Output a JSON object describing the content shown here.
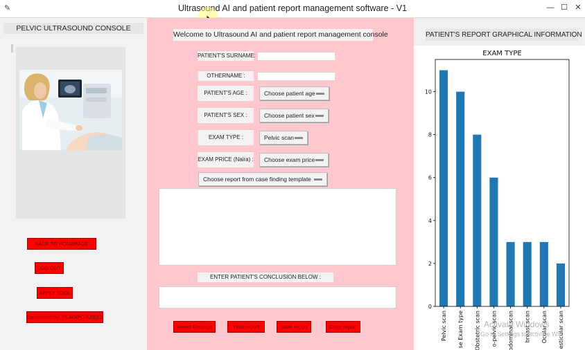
{
  "window": {
    "title": "Ultrasound AI and patient report management software - V1"
  },
  "left": {
    "heading": "PELVIC ULTRASOUND CONSOLE",
    "buttons": [
      {
        "label": "BACK TO HOMEPAGE",
        "name": "back-to-homepage-button"
      },
      {
        "label": "LOG OUT",
        "name": "log-out-button"
      },
      {
        "label": "APPLY TOOL",
        "name": "apply-tool-button"
      },
      {
        "label": "Developed by: OLADIPO AZEEZ",
        "name": "developer-credit-button"
      }
    ]
  },
  "middle": {
    "welcome": "Welcome to Ultrasound AI and patient report management console",
    "surname_label": "PATIENT'S SURNAME:",
    "surname_value": "",
    "othername_label": "OTHERNAME :",
    "othername_value": "",
    "age_label": "PATIENT'S AGE :",
    "age_value": "Choose patient age",
    "sex_label": "PATIENT'S SEX :",
    "sex_value": "Choose patient sex",
    "exam_type_label": "EXAM TYPE :",
    "exam_type_value": "Pelvic scan",
    "exam_price_label": "EXAM PRICE (Naira) :",
    "exam_price_value": "Choose exam price",
    "template_value": "Choose report from case finding template",
    "findings_text": "",
    "conclusion_label": "ENTER PATIENT'S CONCLUSION BELOW :",
    "conclusion_text": "",
    "action_buttons": [
      {
        "label": "Select Findings",
        "name": "select-findings-button"
      },
      {
        "label": "Print report",
        "name": "print-report-button"
      },
      {
        "label": "Save report",
        "name": "save-report-button"
      },
      {
        "label": "Clear report",
        "name": "clear-report-button"
      }
    ]
  },
  "right": {
    "heading": "PATIENT'S REPORT GRAPHICAL INFORMATION"
  },
  "watermark": {
    "line1": "Activate Windows",
    "line2": "Go to Settings to activate Win"
  },
  "chart_data": {
    "type": "bar",
    "title": "EXAM TYPE",
    "categories": [
      "Pelvic scan",
      "Obstetric scan",
      "Obstetric scan",
      "Trans-pelvic scan",
      "Transabdominal scan",
      "breast scan",
      "Ocular scan",
      "Testicular scan"
    ],
    "visible_tick_labels": [
      "Pelvic scan",
      "se Exam type",
      "Obstetric scan",
      "o-pelvic scan",
      "ntabdominal scan",
      "breast scan",
      "Ocular scan",
      "esticular scan"
    ],
    "values": [
      11,
      10,
      8,
      6,
      3,
      3,
      3,
      2
    ],
    "ylim": [
      0,
      11.5
    ],
    "yticks": [
      0,
      2,
      4,
      6,
      8,
      10
    ],
    "bar_color": "#1f77b4",
    "xlabel": "",
    "ylabel": ""
  }
}
